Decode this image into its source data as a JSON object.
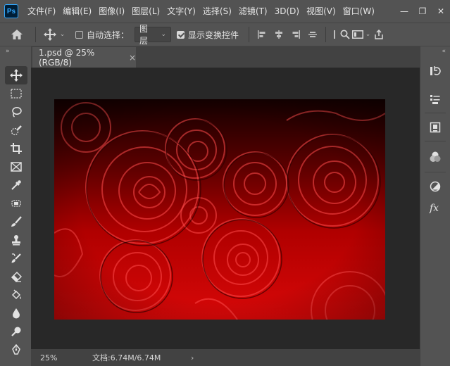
{
  "app": {
    "logo": "Ps"
  },
  "menu": {
    "items": [
      "文件(F)",
      "编辑(E)",
      "图像(I)",
      "图层(L)",
      "文字(Y)",
      "选择(S)",
      "滤镜(T)",
      "3D(D)",
      "视图(V)",
      "窗口(W)"
    ]
  },
  "window_controls": {
    "minimize": "—",
    "restore": "❐",
    "close": "✕"
  },
  "options": {
    "auto_select_label": "自动选择：",
    "auto_select_checked": false,
    "auto_select_target": "图层",
    "show_transform_label": "显示变换控件",
    "show_transform_checked": true
  },
  "panels": {
    "collapse_left": "»",
    "collapse_right": "«"
  },
  "document": {
    "tab_title": "1.psd @ 25%(RGB/8)",
    "tab_close": "×",
    "zoom": "25%",
    "doc_info": "文档:6.74M/6.74M",
    "status_arrow": "›"
  },
  "tools": [
    "move-tool",
    "marquee-tool",
    "lasso-tool",
    "quick-selection-tool",
    "crop-tool",
    "frame-tool",
    "eyedropper-tool",
    "spot-healing-tool",
    "brush-tool",
    "clone-stamp-tool",
    "history-brush-tool",
    "eraser-tool",
    "paint-bucket-tool",
    "blur-tool",
    "dodge-tool",
    "pen-tool"
  ],
  "right_panel": [
    "history-icon",
    "properties-icon",
    "libraries-icon",
    "color-icon",
    "adjustments-icon",
    "styles-icon"
  ],
  "colors": {
    "ui_bg": "#535353",
    "doc_bg": "#282828",
    "image_red": "#c00000",
    "image_dark": "#1a0000"
  }
}
